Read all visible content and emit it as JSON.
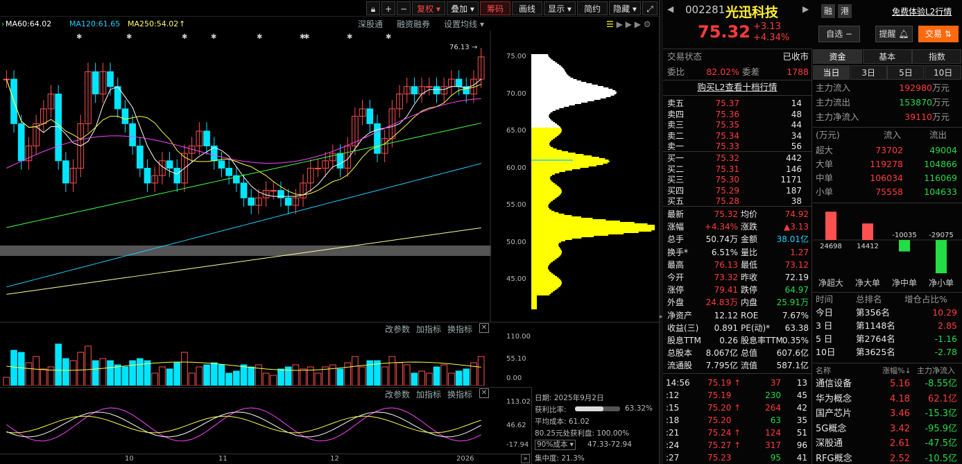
{
  "toolbar": {
    "items": [
      "复权",
      "叠加",
      "筹码",
      "画线",
      "显示",
      "简约",
      "隐藏"
    ],
    "mini": [
      "+",
      "−"
    ]
  },
  "ma_legend": [
    {
      "label": "MA60:64.02",
      "color": "#ffffff"
    },
    {
      "label": "MA120:61.65",
      "color": "#22ccff"
    },
    {
      "label": "MA250:54.02",
      "color": "#ffff66"
    }
  ],
  "chart_links": [
    "深股通",
    "融资融券",
    "设置均线"
  ],
  "price_axis": [
    "75.00",
    "70.00",
    "65.00",
    "60.00",
    "55.00",
    "50.00",
    "45.00"
  ],
  "high_marker": "76.13",
  "vol_axis": [
    "110.00",
    "55.10",
    "0.00"
  ],
  "ind_axis": [
    "113.02",
    "46.62",
    "-17.94"
  ],
  "sub_links": [
    "改参数",
    "加指标",
    "换指标"
  ],
  "x_axis": [
    "10",
    "11",
    "12",
    "2026"
  ],
  "chip": {
    "date": "日期: 2025年9月2日",
    "profit_label": "获利比率:",
    "profit_value": "63.32%",
    "profit_ratio": 0.6332,
    "avg_cost": "平均成本: 61.02",
    "profit_at": "80.25元处获利盘: 100.00%",
    "cost_select": "90%成本",
    "cost_range": "47.33-72.94",
    "concentration": "集中度: 21.3%"
  },
  "stock": {
    "code": "002281",
    "name": "光迅科技",
    "tags": [
      "融",
      "港"
    ],
    "l2_link": "免费体验L2行情",
    "price": "75.32",
    "change": "+3.13",
    "change_pct": "+4.34%",
    "btn_watch": "自选 −",
    "btn_remind": "提醒",
    "btn_trade": "交易"
  },
  "status": {
    "label": "交易状态",
    "value": "已收市",
    "wb_label": "委比",
    "wb": "82.02%",
    "wc_label": "委差",
    "wc": "1788"
  },
  "l2_text": "购买L2查看十档行情",
  "asks": [
    {
      "name": "卖五",
      "price": "75.37",
      "vol": "14"
    },
    {
      "name": "卖四",
      "price": "75.36",
      "vol": "48"
    },
    {
      "name": "卖三",
      "price": "75.35",
      "vol": "44"
    },
    {
      "name": "卖二",
      "price": "75.34",
      "vol": "34"
    },
    {
      "name": "卖一",
      "price": "75.33",
      "vol": "56"
    }
  ],
  "bids": [
    {
      "name": "买一",
      "price": "75.32",
      "vol": "442"
    },
    {
      "name": "买二",
      "price": "75.31",
      "vol": "146"
    },
    {
      "name": "买三",
      "price": "75.30",
      "vol": "1171"
    },
    {
      "name": "买四",
      "price": "75.29",
      "vol": "187"
    },
    {
      "name": "买五",
      "price": "75.28",
      "vol": "38"
    }
  ],
  "stats": [
    {
      "l": "最新",
      "v": "75.32",
      "vc": "red",
      "l2": "均价",
      "v2": "74.92",
      "v2c": "red"
    },
    {
      "l": "涨幅",
      "v": "+4.34%",
      "vc": "red",
      "l2": "涨跌",
      "v2": "▲3.13",
      "v2c": "red"
    },
    {
      "l": "总手",
      "v": "50.74万",
      "vc": "wht",
      "l2": "金额",
      "v2": "38.01亿",
      "v2c": "cyan"
    },
    {
      "l": "换手*",
      "v": "6.51%",
      "vc": "wht",
      "l2": "量比",
      "v2": "1.27",
      "v2c": "red"
    },
    {
      "l": "最高",
      "v": "76.13",
      "vc": "red",
      "l2": "最低",
      "v2": "73.12",
      "v2c": "red"
    },
    {
      "l": "今开",
      "v": "73.32",
      "vc": "red",
      "l2": "昨收",
      "v2": "72.19",
      "v2c": "wht"
    },
    {
      "l": "涨停",
      "v": "79.41",
      "vc": "red",
      "l2": "跌停",
      "v2": "64.97",
      "v2c": "grn"
    },
    {
      "l": "外盘",
      "v": "24.83万",
      "vc": "red",
      "l2": "内盘",
      "v2": "25.91万",
      "v2c": "grn"
    },
    {
      "l": "净资产",
      "v": "12.12",
      "vc": "wht",
      "l2": "ROE",
      "v2": "7.67%",
      "v2c": "wht"
    },
    {
      "l": "收益(三)",
      "v": "0.891",
      "vc": "wht",
      "l2": "PE(动)*",
      "v2": "63.38",
      "v2c": "wht"
    },
    {
      "l": "股息TTM",
      "v": "0.26",
      "vc": "wht",
      "l2": "股息率TTM",
      "v2": "0.35%",
      "v2c": "wht"
    },
    {
      "l": "总股本",
      "v": "8.067亿",
      "vc": "wht",
      "l2": "总值",
      "v2": "607.6亿",
      "v2c": "wht"
    },
    {
      "l": "流通股",
      "v": "7.795亿",
      "vc": "wht",
      "l2": "流值",
      "v2": "587.1亿",
      "v2c": "wht"
    }
  ],
  "ticks": [
    {
      "t": "14:56",
      "p": "75.19",
      "up": true,
      "v": "37",
      "n": "13"
    },
    {
      "t": ":12",
      "p": "75.19",
      "up": false,
      "v": "230",
      "n": "45"
    },
    {
      "t": ":15",
      "p": "75.20",
      "up": true,
      "v": "264",
      "n": "42"
    },
    {
      "t": ":18",
      "p": "75.20",
      "up": false,
      "v": "63",
      "n": "35"
    },
    {
      "t": ":21",
      "p": "75.24",
      "up": true,
      "v": "124",
      "n": "51"
    },
    {
      "t": ":24",
      "p": "75.27",
      "up": true,
      "v": "317",
      "n": "96"
    },
    {
      "t": ":27",
      "p": "75.23",
      "up": false,
      "v": "95",
      "n": "41"
    }
  ],
  "fund_tabs": [
    "资金",
    "基本",
    "指数"
  ],
  "period_tabs": [
    "当日",
    "3日",
    "5日",
    "10日"
  ],
  "flows": [
    {
      "l": "主力流入",
      "v": "192980",
      "u": "万元",
      "c": "red"
    },
    {
      "l": "主力流出",
      "v": "153870",
      "u": "万元",
      "c": "grn"
    },
    {
      "l": "主力净流入",
      "v": "39110",
      "u": "万元",
      "c": "red"
    }
  ],
  "flow_head": {
    "unit": "(万元)",
    "in": "流入",
    "out": "流出"
  },
  "flow_table": [
    {
      "l": "超大",
      "in": "73702",
      "out": "49004"
    },
    {
      "l": "大单",
      "in": "119278",
      "out": "104866"
    },
    {
      "l": "中单",
      "in": "106034",
      "out": "116069"
    },
    {
      "l": "小单",
      "in": "75558",
      "out": "104633"
    }
  ],
  "net_bars": [
    {
      "label": "净超大",
      "value": 24698
    },
    {
      "label": "净大单",
      "value": 14412
    },
    {
      "label": "净中单",
      "value": -10035
    },
    {
      "label": "净小单",
      "value": -29075
    }
  ],
  "net_bar_labels": [
    "24698",
    "14412",
    "-10035",
    "-29075"
  ],
  "rank_head": {
    "c1": "时间",
    "c2": "总排名",
    "c3": "增仓占比%"
  },
  "ranks": [
    {
      "t": "今日",
      "r": "第356名",
      "v": "10.29",
      "c": "red"
    },
    {
      "t": "3 日",
      "r": "第1148名",
      "v": "2.85",
      "c": "red"
    },
    {
      "t": "5 日",
      "r": "第2764名",
      "v": "-1.16",
      "c": "grn"
    },
    {
      "t": "10日",
      "r": "第3625名",
      "v": "-2.78",
      "c": "grn"
    }
  ],
  "sector_head": {
    "c1": "名称",
    "c2": "涨幅%↓",
    "c3": "主力净流入"
  },
  "sectors": [
    {
      "n": "通信设备",
      "p": "5.16",
      "f": "-8.55亿",
      "fc": "grn"
    },
    {
      "n": "华为概念",
      "p": "4.18",
      "f": "62.1亿",
      "fc": "red"
    },
    {
      "n": "国产芯片",
      "p": "3.46",
      "f": "-15.3亿",
      "fc": "grn"
    },
    {
      "n": "5G概念",
      "p": "3.42",
      "f": "-95.9亿",
      "fc": "grn"
    },
    {
      "n": "深股通",
      "p": "2.61",
      "f": "-47.5亿",
      "fc": "grn"
    },
    {
      "n": "RFG概念",
      "p": "2.52",
      "f": "-10.5亿",
      "fc": "grn"
    }
  ],
  "colors": {
    "up": "#ff3b3b",
    "down": "#00e5ff",
    "bg": "#000000",
    "chip_yellow": "#ffff00"
  }
}
